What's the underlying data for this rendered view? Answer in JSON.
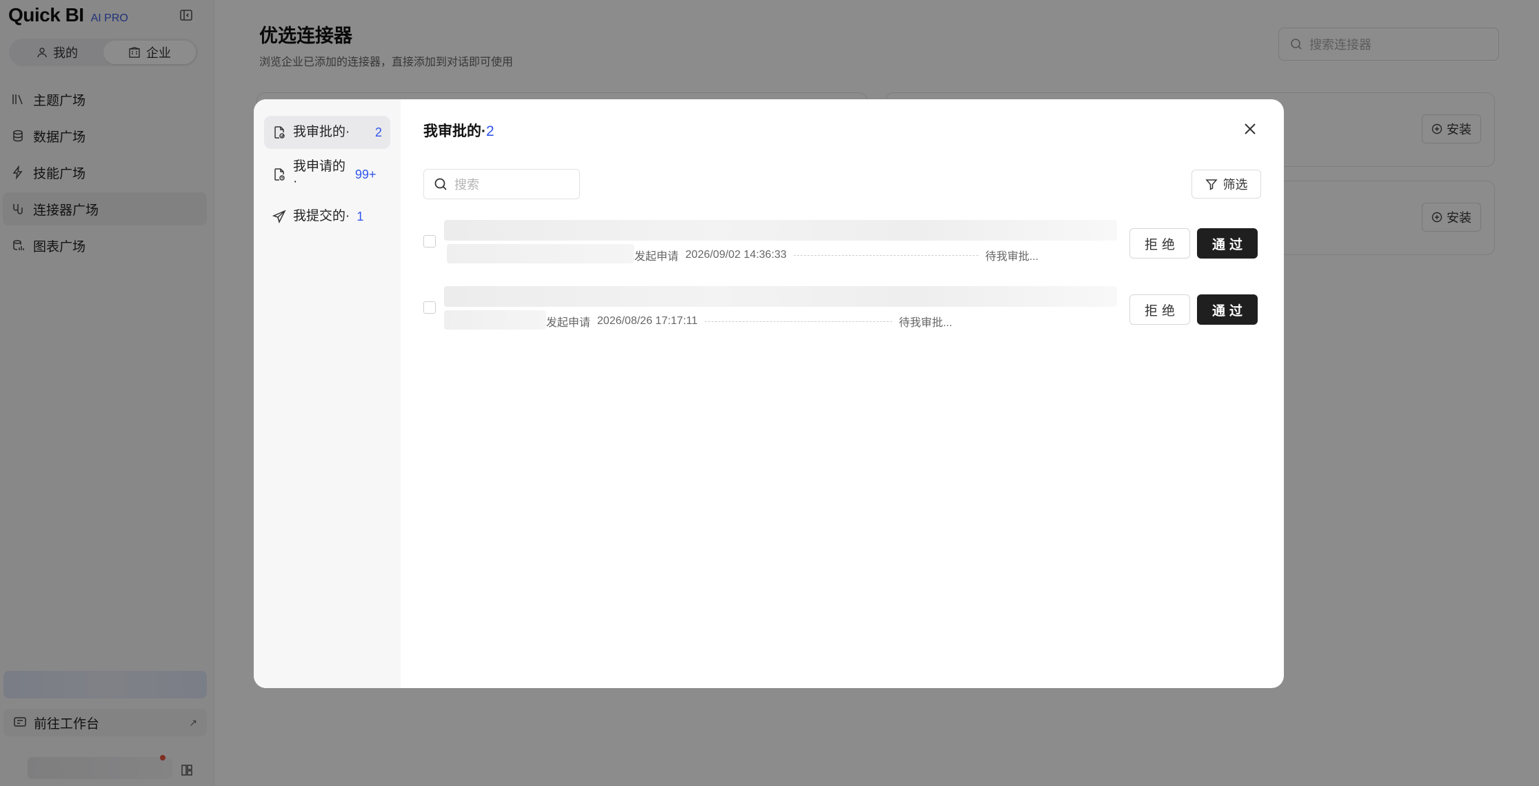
{
  "app": {
    "logo": "Quick BI",
    "badge": "AI PRO"
  },
  "scope_tabs": [
    {
      "label": "我的"
    },
    {
      "label": "企业"
    }
  ],
  "nav": [
    {
      "label": "主题广场"
    },
    {
      "label": "数据广场"
    },
    {
      "label": "技能广场"
    },
    {
      "label": "连接器广场"
    },
    {
      "label": "图表广场"
    }
  ],
  "workbench_label": "前往工作台",
  "page": {
    "title": "优选连接器",
    "subtitle": "浏览企业已添加的连接器，直接添加到对话即可使用",
    "search_placeholder": "搜索连接器",
    "install_label": "安装"
  },
  "modal": {
    "tabs": [
      {
        "label": "我审批的·",
        "count": "2"
      },
      {
        "label": "我申请的·",
        "count": "99+"
      },
      {
        "label": "我提交的·",
        "count": "1"
      }
    ],
    "title": "我审批的·",
    "title_count": "2",
    "search_placeholder": "搜索",
    "filter_label": "筛选",
    "rows": [
      {
        "action": "发起申请",
        "time": "2026/09/02 14:36:33",
        "status": "待我审批...",
        "reject": "拒绝",
        "approve": "通过"
      },
      {
        "action": "发起申请",
        "time": "2026/08/26 17:17:11",
        "status": "待我审批...",
        "reject": "拒绝",
        "approve": "通过"
      }
    ]
  }
}
